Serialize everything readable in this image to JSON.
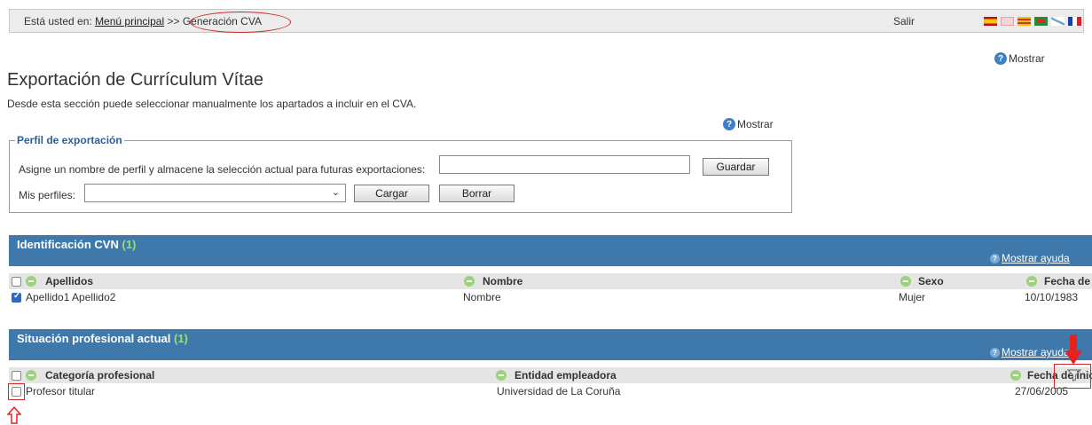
{
  "topbar": {
    "prefix": "Está usted en:",
    "menu_link": "Menú principal",
    "separator": ">>",
    "current": "Generación CVA",
    "logout": "Salir",
    "flags": [
      "es",
      "uk",
      "ca",
      "eu",
      "gl",
      "fr"
    ]
  },
  "help": {
    "show": "Mostrar"
  },
  "page": {
    "title": "Exportación de Currículum Vítae",
    "description": "Desde esta sección puede seleccionar manualmente los apartados a incluir en el CVA."
  },
  "profile": {
    "legend": "Perfil de exportación",
    "name_label": "Asigne un nombre de perfil y almacene la selección actual para futuras exportaciones:",
    "name_value": "",
    "save_label": "Guardar",
    "profiles_label": "Mis perfiles:",
    "profiles_selected": "",
    "load_label": "Cargar",
    "delete_label": "Borrar"
  },
  "sections": [
    {
      "title": "Identificación CVN",
      "count": "(1)",
      "help_link": "Mostrar ayuda",
      "columns": [
        "Apellidos",
        "Nombre",
        "Sexo",
        "Fecha de"
      ],
      "rows": [
        {
          "checked": true,
          "cells": [
            "Apellido1 Apellido2",
            "Nombre",
            "Mujer",
            "10/10/1983"
          ]
        }
      ]
    },
    {
      "title": "Situación profesional actual",
      "count": "(1)",
      "help_link": "Mostrar ayuda",
      "columns": [
        "Categoría profesional",
        "Entidad empleadora",
        "Fecha de inicio"
      ],
      "rows": [
        {
          "checked": false,
          "cells": [
            "Profesor titular",
            "Universidad de La Coruña",
            "27/06/2005"
          ]
        }
      ]
    }
  ],
  "colors": {
    "section_header": "#3f79ac",
    "count_green": "#9de15a",
    "annotation_red": "#d3262a",
    "legend_blue": "#2d5f93"
  }
}
